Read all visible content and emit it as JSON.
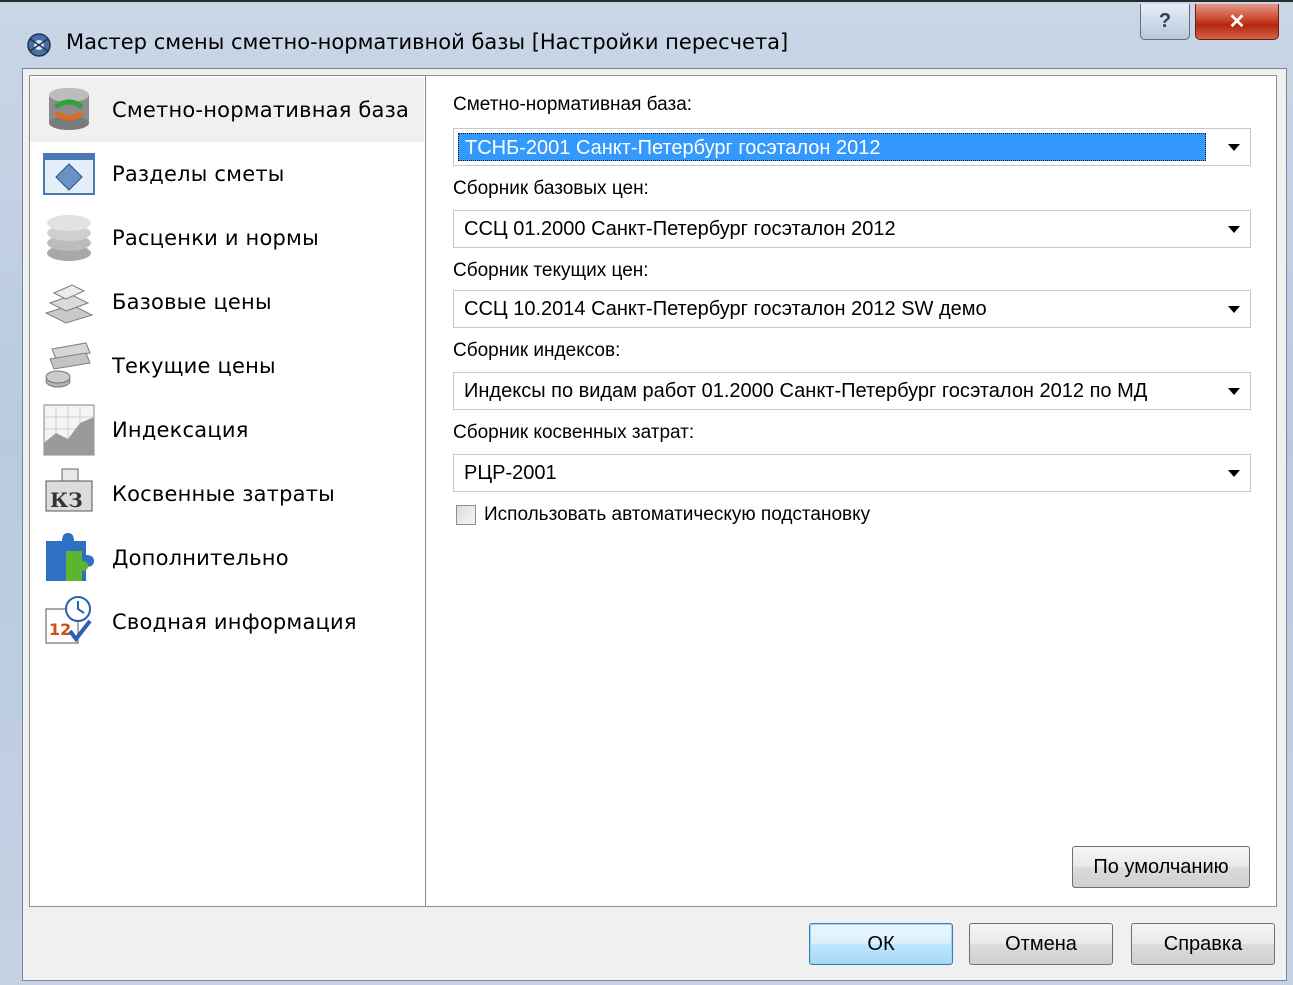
{
  "window": {
    "title": "Мастер смены сметно-нормативной базы [Настройки пересчета]",
    "help_label": "?",
    "close_label": "✕"
  },
  "nav": {
    "items": [
      {
        "label": "Сметно-нормативная база",
        "icon": "database-refresh-icon",
        "selected": true
      },
      {
        "label": "Разделы сметы",
        "icon": "sections-icon",
        "selected": false
      },
      {
        "label": "Расценки и нормы",
        "icon": "stack-disks-icon",
        "selected": false
      },
      {
        "label": "Базовые цены",
        "icon": "bars-icon",
        "selected": false
      },
      {
        "label": "Текущие цены",
        "icon": "coins-icon",
        "selected": false
      },
      {
        "label": "Индексация",
        "icon": "chart-icon",
        "selected": false
      },
      {
        "label": "Косвенные затраты",
        "icon": "kz-calculator-icon",
        "selected": false
      },
      {
        "label": "Дополнительно",
        "icon": "puzzle-icon",
        "selected": false
      },
      {
        "label": "Сводная информация",
        "icon": "calendar-clock-icon",
        "selected": false
      }
    ]
  },
  "form": {
    "base_label": "Сметно-нормативная база:",
    "base_value": "ТСНБ-2001 Санкт-Петербург госэталон 2012",
    "base_prices_label": "Сборник базовых цен:",
    "base_prices_value": "ССЦ 01.2000 Санкт-Петербург госэталон 2012",
    "current_prices_label": "Сборник текущих цен:",
    "current_prices_value": "ССЦ 10.2014 Санкт-Петербург госэталон 2012 SW демо",
    "indexes_label": "Сборник индексов:",
    "indexes_value": "Индексы по видам работ 01.2000 Санкт-Петербург госэталон 2012 по МД",
    "indirect_label": "Сборник косвенных затрат:",
    "indirect_value": "РЦР-2001",
    "auto_substitution_label": "Использовать автоматическую подстановку",
    "auto_substitution_checked": false,
    "default_button": "По умолчанию"
  },
  "footer": {
    "ok": "ОК",
    "cancel": "Отмена",
    "help": "Справка"
  },
  "colors": {
    "selection": "#3399ff",
    "close_button": "#c9452d"
  }
}
